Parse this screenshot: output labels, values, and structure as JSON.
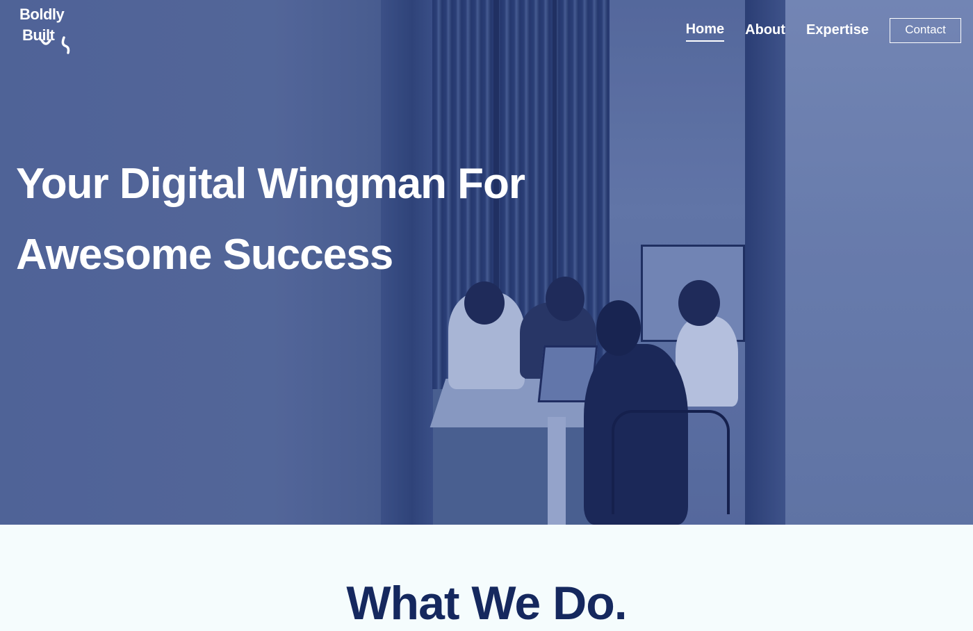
{
  "brand": {
    "logo_line1": "Boldly",
    "logo_line2": "Built"
  },
  "nav": {
    "items": [
      {
        "label": "Home",
        "active": true
      },
      {
        "label": "About",
        "active": false
      },
      {
        "label": "Expertise",
        "active": false
      }
    ],
    "cta_label": "Contact"
  },
  "hero": {
    "title_line1": "Your Digital Wingman For",
    "title_line2": "Awesome Success"
  },
  "section": {
    "title": "What We Do."
  },
  "colors": {
    "hero_overlay": "#4f6492",
    "heading_navy": "#15285e",
    "page_bg": "#f5fcfd",
    "text_white": "#ffffff"
  }
}
